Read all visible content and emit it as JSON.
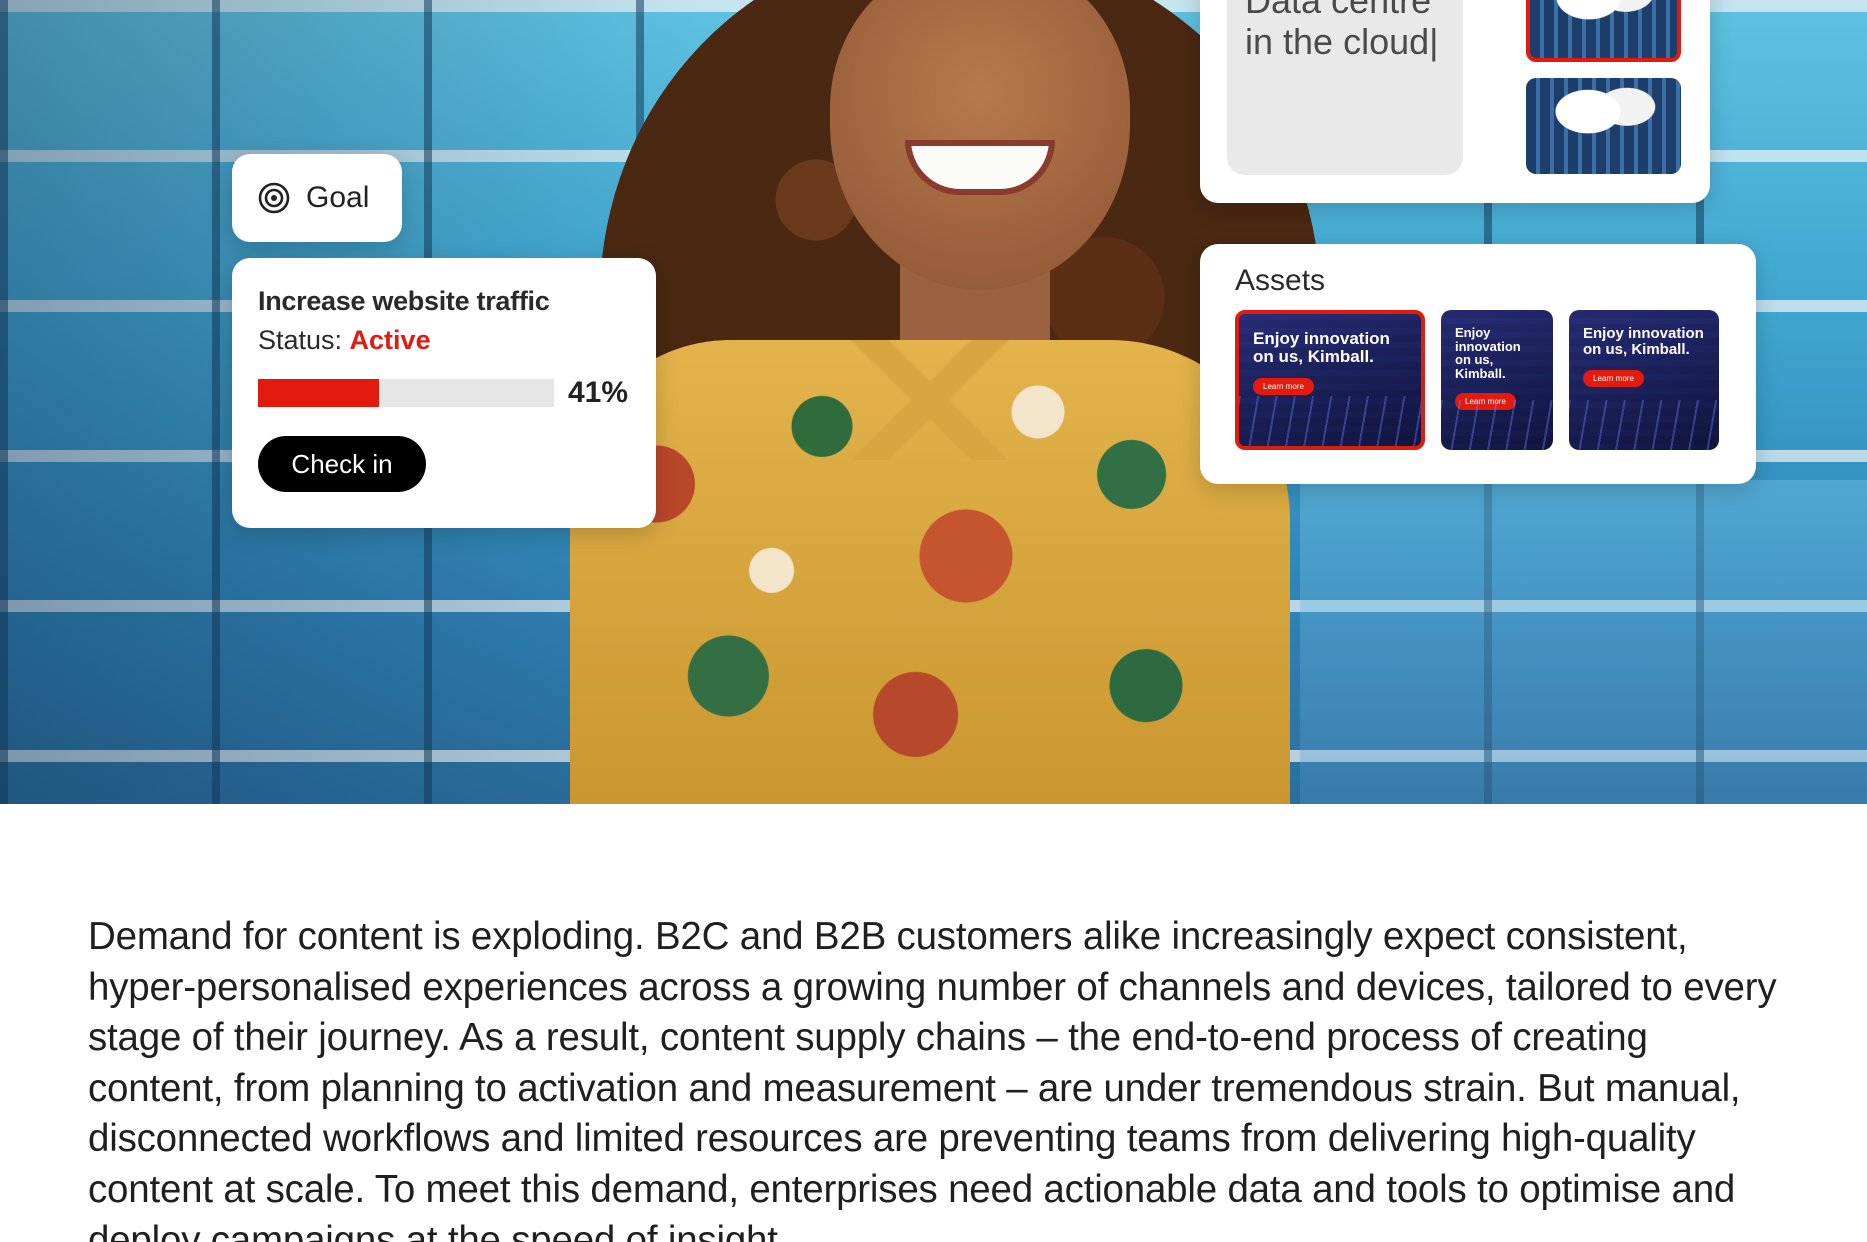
{
  "goal_pill": {
    "label": "Goal",
    "icon": "target-icon"
  },
  "goal_card": {
    "title": "Increase website traffic",
    "status_label": "Status: ",
    "status_value": "Active",
    "progress": 0.41,
    "progress_text": "41%",
    "check_in_label": "Check in"
  },
  "data_centre_card": {
    "text": "Data centre in the cloud|"
  },
  "assets_card": {
    "title": "Assets",
    "items": [
      {
        "headline": "Enjoy innovation on us, Kimball.",
        "cta": "Learn more",
        "selected": true
      },
      {
        "headline": "Enjoy innovation on us, Kimball.",
        "cta": "Learn more",
        "selected": false
      },
      {
        "headline": "Enjoy innovation on us, Kimball.",
        "cta": "Learn more",
        "selected": false
      }
    ]
  },
  "body": {
    "paragraph": "Demand for content is exploding. B2C and B2B customers alike increasingly expect consistent, hyper-personalised experiences across a growing number of channels and devices, tailored to every stage of their journey. As a result, content supply chains – the end-to-end process of creating content, from planning to activation and measurement – are under tremendous strain. But manual, disconnected workflows and limited resources are preventing teams from delivering high-quality content at scale. To meet this demand, enterprises need actionable data and tools to optimise and deploy campaigns at the speed of insight."
  },
  "colors": {
    "accent": "#e31a0e",
    "button_bg": "#000000",
    "progress_track": "#e6e6e6"
  }
}
